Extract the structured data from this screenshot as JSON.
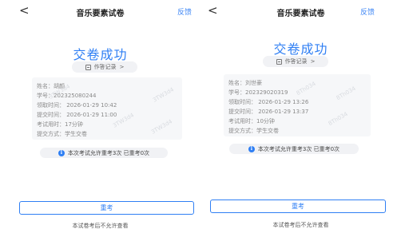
{
  "screens": [
    {
      "nav": {
        "back_glyph": "<",
        "title": "音乐要素试卷",
        "feedback": "反馈"
      },
      "success_title": "交卷成功",
      "record_button": {
        "icon": "document-icon",
        "label": "作答记录",
        "chevron": ">"
      },
      "info": {
        "name": "姓名：胡颜",
        "student_id": "学号：202325080244",
        "receive_time": "领取时间：  2026-01-29 10:42",
        "submit_time": "提交时间：  2026-01-29 11:00",
        "duration": "考试用时：17分钟",
        "submit_method": "提交方式：学生交卷",
        "watermarks": [
          "3TW3d4",
          "3TW3d4",
          "3TW3d4",
          "3TW3d4"
        ]
      },
      "notice": {
        "icon": "info-icon",
        "text": "本次考试允许重考3次 已重考0次"
      },
      "retake_button": "重考",
      "footer_note": "本试卷考后不允许查看"
    },
    {
      "nav": {
        "back_glyph": "<",
        "title": "音乐要素试卷",
        "feedback": "反馈"
      },
      "success_title": "交卷成功",
      "record_button": {
        "icon": "document-icon",
        "label": "作答记录",
        "chevron": ">"
      },
      "info": {
        "name": "姓名：刘世豪",
        "student_id": "学号：202329020319",
        "receive_time": "领取时间：  2026-01-29 13:26",
        "submit_time": "提交时间：  2026-01-29 13:37",
        "duration": "考试用时：10分钟",
        "submit_method": "提交方式：学生交卷",
        "watermarks": [
          "8Th034",
          "8Th034",
          "8Th034"
        ]
      },
      "notice": {
        "icon": "info-icon",
        "text": "本次考试允许重考3次 已重考0次"
      },
      "retake_button": "重考",
      "footer_note": "本试卷考后不允许查看"
    }
  ]
}
